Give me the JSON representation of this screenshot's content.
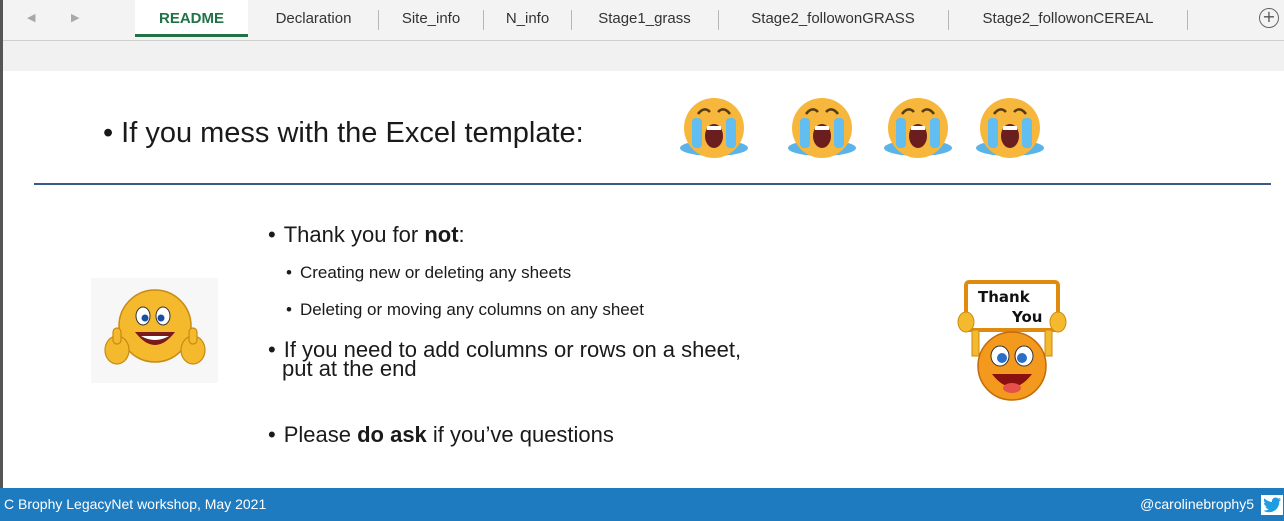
{
  "tabs": {
    "items": [
      {
        "label": "README",
        "active": true
      },
      {
        "label": "Declaration"
      },
      {
        "label": "Site_info"
      },
      {
        "label": "N_info"
      },
      {
        "label": "Stage1_grass"
      },
      {
        "label": "Stage2_followonGRASS"
      },
      {
        "label": "Stage2_followonCEREAL"
      }
    ],
    "prev_glyph": "◀",
    "next_glyph": "▶",
    "add_glyph": "+"
  },
  "slide": {
    "heading": "If you mess with the Excel template:",
    "bullets": {
      "thanks_prefix": "Thank you for ",
      "thanks_bold": "not",
      "thanks_suffix": ":",
      "sub1": "Creating new or deleting any sheets",
      "sub2": "Deleting or moving any columns on any sheet",
      "add_line1": "If you need to add columns or rows on a sheet,",
      "add_line2": "put at the end",
      "ask_prefix": "Please ",
      "ask_bold": "do ask",
      "ask_suffix": " if you’ve questions"
    },
    "sign": {
      "line1": "Thank",
      "line2": "You"
    },
    "icons": [
      "crying-face-icon",
      "thumbs-up-smiley-icon",
      "thank-you-sign-smiley-icon",
      "twitter-icon"
    ]
  },
  "footer": {
    "left": "C Brophy LegacyNet workshop, May 2021",
    "right": "@carolinebrophy5"
  },
  "colors": {
    "excel_green": "#217346",
    "footer_blue": "#1e7bbf",
    "rule_blue": "#3a5a8c"
  }
}
